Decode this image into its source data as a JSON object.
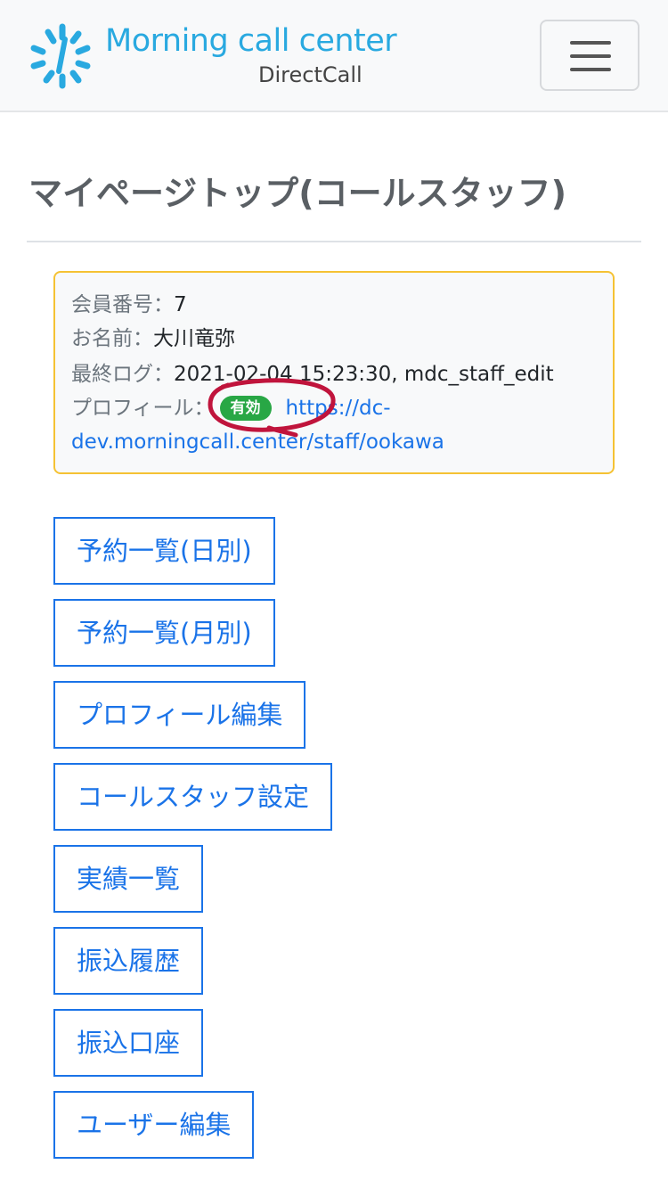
{
  "brand": {
    "title": "Morning call center",
    "subtitle": "DirectCall",
    "color": "#29a9e0"
  },
  "navbar": {
    "toggler_icon": "hamburger-menu-icon"
  },
  "page": {
    "title": "マイページトップ(コールスタッフ)"
  },
  "info": {
    "member_no_label": "会員番号：",
    "member_no": "7",
    "name_label": "お名前：",
    "name": "大川竜弥",
    "last_log_label": "最終ログ：",
    "last_log": "2021-02-04 15:23:30, mdc_staff_edit",
    "profile_label": "プロフィール：",
    "profile_badge": "有効",
    "profile_link_line1": "https://dc-",
    "profile_link_line2": "dev.morningcall.center/staff/ookawa"
  },
  "actions": [
    {
      "label": "予約一覧(日別)"
    },
    {
      "label": "予約一覧(月別)"
    },
    {
      "label": "プロフィール編集"
    },
    {
      "label": "コールスタッフ設定"
    },
    {
      "label": "実績一覧"
    },
    {
      "label": "振込履歴"
    },
    {
      "label": "振込口座"
    },
    {
      "label": "ユーザー編集"
    }
  ],
  "colors": {
    "primary": "#1a73e8",
    "success": "#28a745",
    "warning_border": "#f5c233",
    "annotation": "#c0143c"
  }
}
